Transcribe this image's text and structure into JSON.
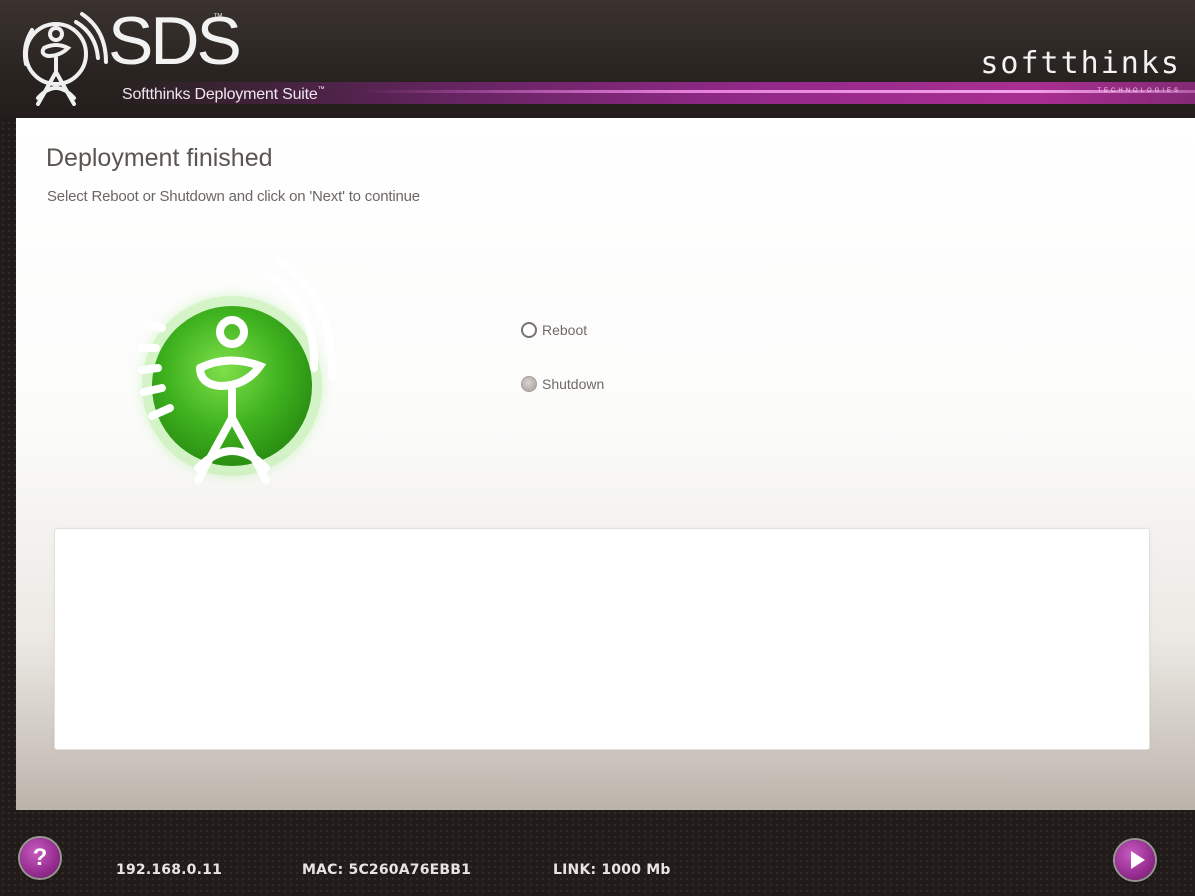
{
  "header": {
    "product_acronym": "SDS",
    "product_acronym_tm": "™",
    "product_name": "Softthinks Deployment Suite",
    "product_name_tm": "™",
    "brand_name": "softthinks",
    "brand_tagline": "TECHNOLOGIES"
  },
  "main": {
    "title": "Deployment finished",
    "instruction": "Select Reboot or Shutdown and click on 'Next' to continue",
    "options": [
      {
        "label": "Reboot",
        "selected": false
      },
      {
        "label": "Shutdown",
        "selected": true
      }
    ],
    "log_text": ""
  },
  "footer": {
    "help_label": "?",
    "ip": "192.168.0.11",
    "mac": "MAC: 5C260A76EBB1",
    "link": "LINK: 1000 Mb",
    "next_icon": "play-arrow-icon"
  },
  "colors": {
    "accent": "#9a2f94",
    "status_green": "#3fb21f",
    "header_band": "#b8309f"
  }
}
